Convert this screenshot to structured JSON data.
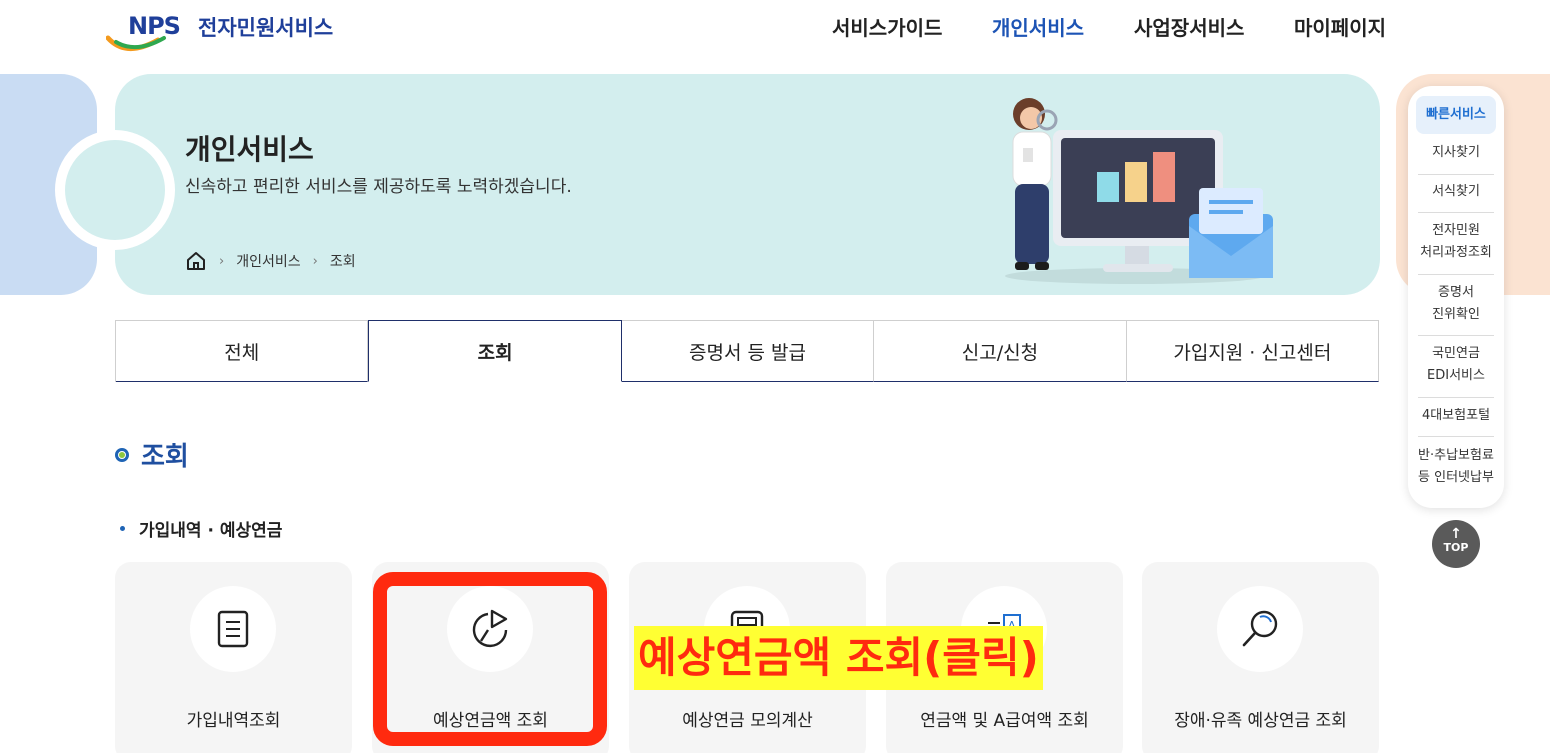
{
  "header": {
    "logo_mark": "NPS",
    "logo_text": "전자민원서비스",
    "nav": [
      "서비스가이드",
      "개인서비스",
      "사업장서비스",
      "마이페이지"
    ],
    "active_nav": "개인서비스"
  },
  "hero": {
    "title": "개인서비스",
    "description": "신속하고 편리한 서비스를 제공하도록 노력하겠습니다.",
    "breadcrumb": [
      "개인서비스",
      "조회"
    ]
  },
  "tabs": [
    "전체",
    "조회",
    "증명서 등 발급",
    "신고/신청",
    "가입지원 · 신고센터"
  ],
  "active_tab": "조회",
  "section": {
    "title": "조회",
    "subtitle": "가입내역 · 예상연금",
    "cards": [
      {
        "label": "가입내역조회",
        "icon": "document-icon"
      },
      {
        "label": "예상연금액 조회",
        "icon": "pie-chart-icon"
      },
      {
        "label": "예상연금 모의계산",
        "icon": "calculator-icon"
      },
      {
        "label": "연금액 및 A급여액 조회",
        "icon": "calendar-a-icon"
      },
      {
        "label": "장애·유족 예상연금 조회",
        "icon": "search-icon"
      }
    ]
  },
  "callout": "예상연금액 조회(클릭)",
  "quick_menu": {
    "head": "빠른서비스",
    "items": [
      [
        "지사찾기"
      ],
      [
        "서식찾기"
      ],
      [
        "전자민원",
        "처리과정조회"
      ],
      [
        "증명서",
        "진위확인"
      ],
      [
        "국민연금",
        "EDI서비스"
      ],
      [
        "4대보험포털"
      ],
      [
        "반·추납보험료",
        "등 인터넷납부"
      ]
    ],
    "top_label": "TOP"
  },
  "colors": {
    "brand_blue": "#1f3f9a",
    "nav_active": "#1d54b5",
    "hero_bg": "#d3eeee",
    "highlight_red": "#ff2a0f",
    "callout_yellow": "#ffff33"
  }
}
